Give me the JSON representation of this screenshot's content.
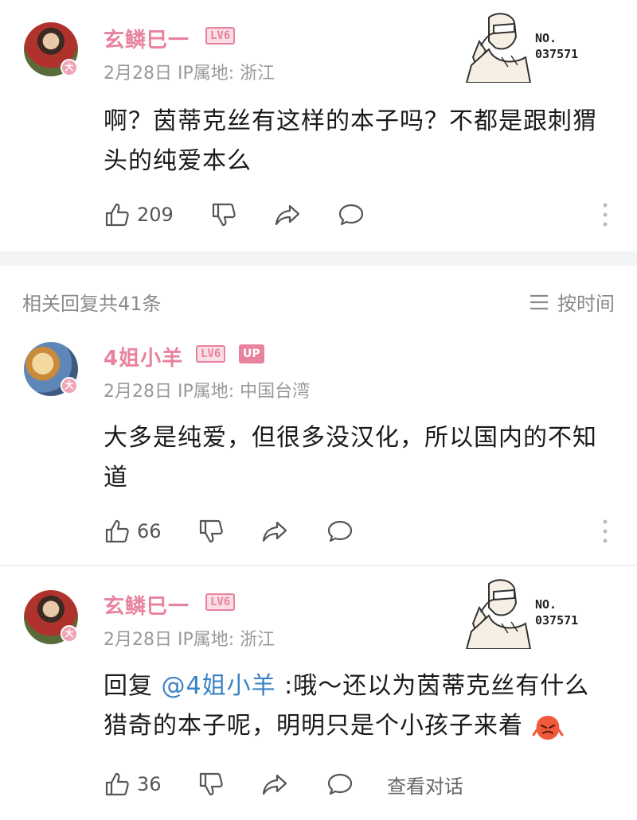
{
  "comments": [
    {
      "username": "玄鳞巳一",
      "level": "LV6",
      "meta": "2月28日 IP属地: 浙江",
      "text": "啊？茵蒂克丝有这样的本子吗？不都是跟刺猬头的纯爱本么",
      "likes": "209",
      "sticker_no": "NO.",
      "sticker_num": "037571"
    }
  ],
  "reply_section": {
    "title": "相关回复共41条",
    "sort_label": "按时间"
  },
  "replies": [
    {
      "username": "4姐小羊",
      "level": "LV6",
      "up_badge": "UP",
      "meta": "2月28日 IP属地: 中国台湾",
      "text": "大多是纯爱，但很多没汉化，所以国内的不知道",
      "likes": "66"
    },
    {
      "username": "玄鳞巳一",
      "level": "LV6",
      "meta": "2月28日 IP属地: 浙江",
      "reply_prefix": "回复 ",
      "mention": "@4姐小羊",
      "text": " :哦～还以为茵蒂克丝有什么猎奇的本子呢，明明只是个小孩子来着",
      "likes": "36",
      "view_dialog": "查看对话",
      "sticker_no": "NO.",
      "sticker_num": "037571"
    }
  ],
  "badge_glyph": "大",
  "colors": {
    "username": "#e8829d",
    "mention": "#3b82c4",
    "meta": "#999999"
  },
  "icons": [
    "like-icon",
    "dislike-icon",
    "share-icon",
    "comment-icon",
    "more-icon",
    "sort-icon"
  ]
}
